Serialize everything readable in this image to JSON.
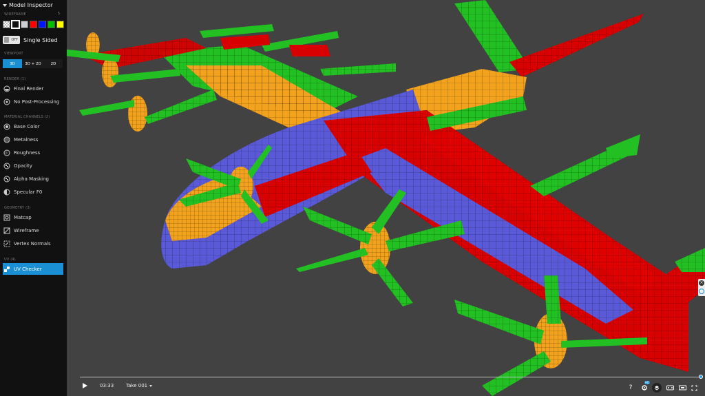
{
  "inspector": {
    "title": "Model Inspector",
    "wireframe_label": "WIREFRAME",
    "wireframe_value": "5",
    "swatches": [
      "checker",
      "#ffffff",
      "#bdbdbd",
      "#ff0000",
      "#0015ff",
      "#00c000",
      "#ffff00"
    ],
    "single_sided_toggle": "OFF",
    "single_sided_label": "Single Sided",
    "viewport_label": "VIEWPORT",
    "viewport_tabs": [
      "3D",
      "3D + 2D",
      "2D"
    ],
    "render_label": "RENDER (1)",
    "render_items": [
      "Final Render",
      "No Post-Processing"
    ],
    "material_label": "MATERIAL CHANNELS (2)",
    "material_items": [
      "Base Color",
      "Metalness",
      "Roughness",
      "Opacity",
      "Alpha Masking",
      "Specular F0"
    ],
    "geometry_label": "GEOMETRY (3)",
    "geometry_items": [
      "Matcap",
      "Wireframe",
      "Vertex Normals"
    ],
    "uv_label": "UV (4)",
    "uv_items": [
      "UV Checker"
    ]
  },
  "timeline": {
    "time": "03:33",
    "take": "Take 001",
    "progress": 1.0
  },
  "toolbar": {
    "help": "?",
    "settings_badge": "HD"
  },
  "colors": {
    "accent": "#1a8fd4",
    "uv_red": "#e60000",
    "uv_green": "#1fbf1f",
    "uv_blue": "#5a5ad8",
    "uv_orange": "#f2a21d"
  }
}
